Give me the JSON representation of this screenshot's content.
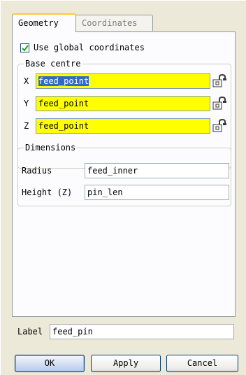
{
  "tabs": [
    {
      "label": "Geometry",
      "active": true
    },
    {
      "label": "Coordinates",
      "active": false
    }
  ],
  "global_coords": {
    "label": "Use global coordinates",
    "checked": true
  },
  "base_centre": {
    "title": "Base centre",
    "rows": [
      {
        "axis": "X",
        "value": "feed_point",
        "selected": true
      },
      {
        "axis": "Y",
        "value": "feed_point",
        "selected": false
      },
      {
        "axis": "Z",
        "value": "feed_point",
        "selected": false
      }
    ],
    "field_color": "#ffff00"
  },
  "dimensions": {
    "title": "Dimensions",
    "radius_label": "Radius",
    "radius_value": "feed_inner",
    "height_label": "Height (Z)",
    "height_value": "pin_len"
  },
  "label_field": {
    "label": "Label",
    "value": "feed_pin"
  },
  "buttons": {
    "ok": "OK",
    "apply": "Apply",
    "cancel": "Cancel"
  },
  "icons": {
    "lock": "lock-icon",
    "check": "checkmark-icon"
  }
}
